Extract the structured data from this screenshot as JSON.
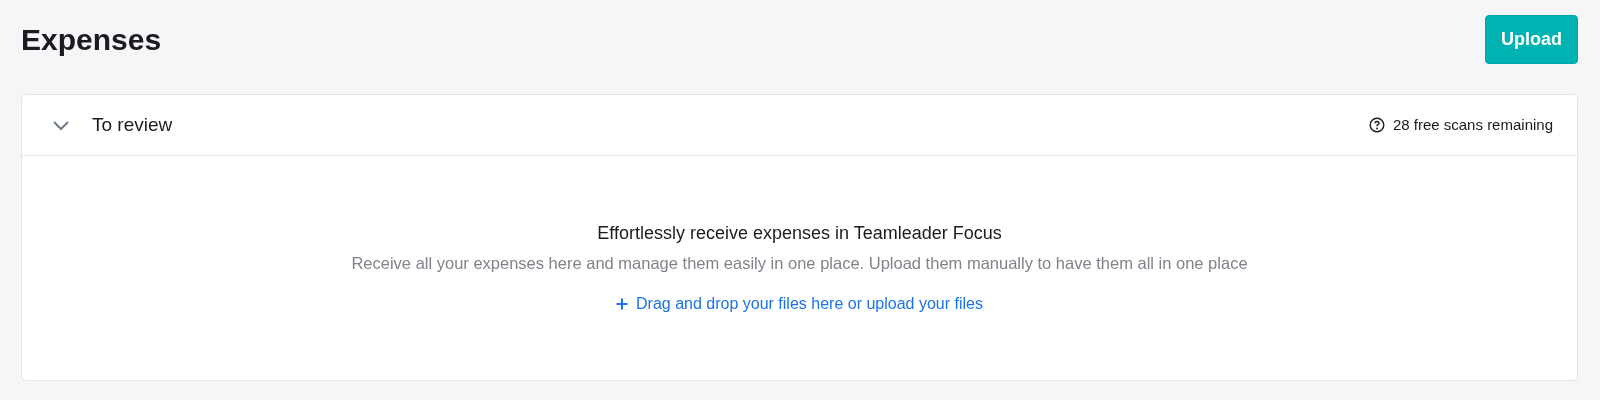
{
  "page": {
    "title": "Expenses",
    "primary_button": "Upload"
  },
  "section": {
    "title": "To review",
    "expanded": true,
    "scans_info": "28 free scans remaining",
    "empty_state": {
      "heading": "Effortlessly receive expenses in Teamleader Focus",
      "description": "Receive all your expenses here and manage them easily in one place. Upload them manually to have them all in one place",
      "action": "Drag and drop your files here or upload your files"
    }
  }
}
